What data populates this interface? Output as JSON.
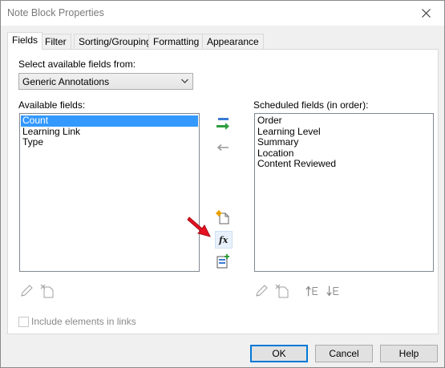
{
  "window": {
    "title": "Note Block Properties"
  },
  "tabs": [
    {
      "label": "Fields",
      "active": true
    },
    {
      "label": "Filter",
      "active": false
    },
    {
      "label": "Sorting/Grouping",
      "active": false
    },
    {
      "label": "Formatting",
      "active": false
    },
    {
      "label": "Appearance",
      "active": false
    }
  ],
  "fields_tab": {
    "select_from_label": "Select available fields from:",
    "select_from_value": "Generic Annotations",
    "available_label": "Available fields:",
    "available_items": [
      "Count",
      "Learning Link",
      "Type"
    ],
    "available_selected": "Count",
    "scheduled_label": "Scheduled fields (in order):",
    "scheduled_items": [
      "Order",
      "Learning Level",
      "Summary",
      "Location",
      "Content Reviewed"
    ],
    "include_links_label": "Include elements in links"
  },
  "buttons": {
    "ok": "OK",
    "cancel": "Cancel",
    "help": "Help"
  },
  "icons": {
    "add_field": "add-field-arrow-icon",
    "remove_field": "remove-field-arrow-icon",
    "new_parameter": "new-parameter-icon",
    "calculated_value": "fx-icon",
    "combine_parameters": "combine-parameters-icon",
    "edit": "pencil-icon",
    "delete": "delete-parameter-icon",
    "move_up": "move-up-icon",
    "move_down": "move-down-icon",
    "annotation_arrow": "red-arrow-icon"
  },
  "colors": {
    "selection": "#3399ff",
    "default_button_border": "#0078d7",
    "add_arrow_green": "#2e9e3e",
    "annotation_red": "#e81123"
  }
}
